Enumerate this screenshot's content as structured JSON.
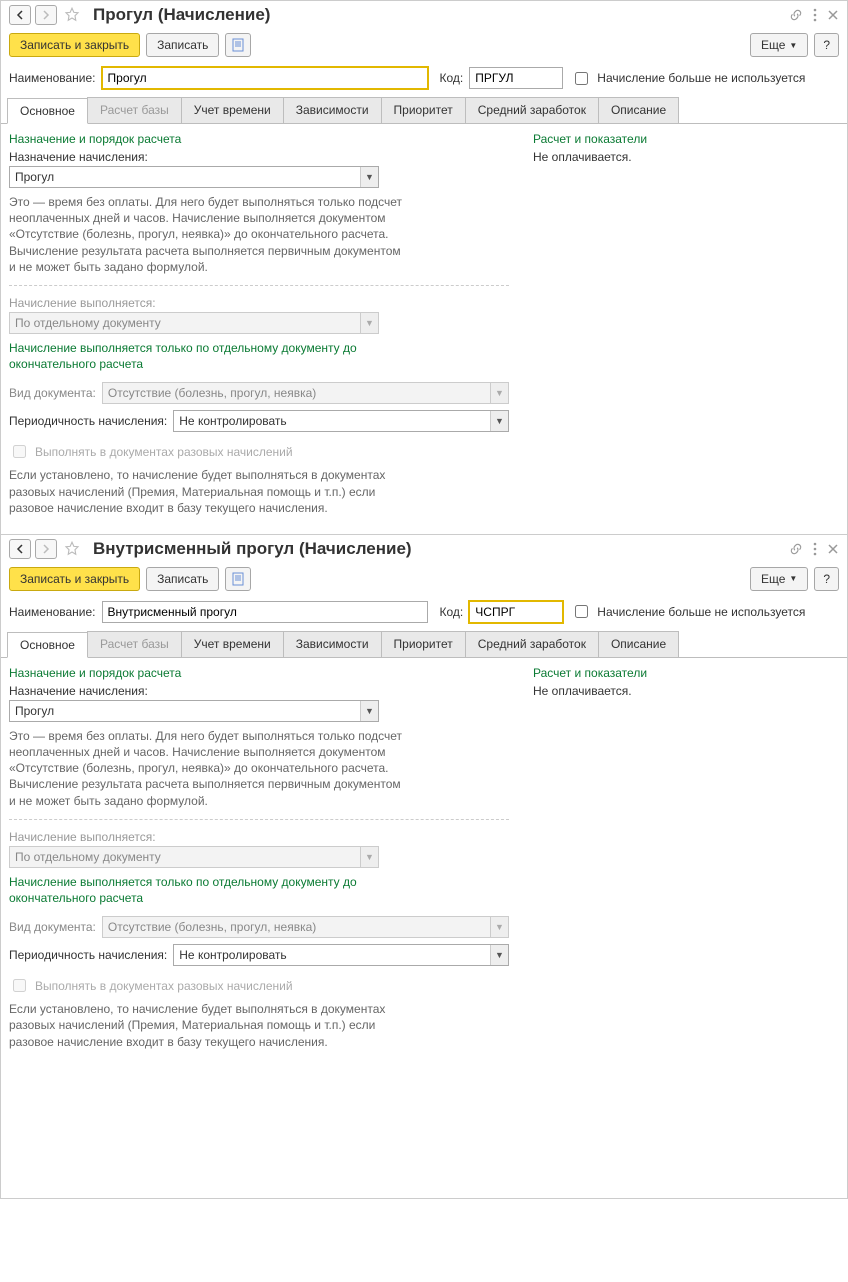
{
  "window1": {
    "title": "Прогул (Начисление)",
    "toolbar": {
      "save_close": "Записать и закрыть",
      "save": "Записать",
      "more": "Еще",
      "help": "?"
    },
    "fields": {
      "name_label": "Наименование:",
      "name_value": "Прогул",
      "code_label": "Код:",
      "code_value": "ПРГУЛ",
      "not_used": "Начисление больше не используется"
    },
    "tabs": [
      "Основное",
      "Расчет базы",
      "Учет времени",
      "Зависимости",
      "Приоритет",
      "Средний заработок",
      "Описание"
    ],
    "left": {
      "h1": "Назначение и порядок расчета",
      "assign_label": "Назначение начисления:",
      "assign_value": "Прогул",
      "desc1": "Это — время без оплаты. Для него будет выполняться только подсчет неоплаченных дней и часов. Начисление выполняется документом «Отсутствие (болезнь, прогул, неявка)» до окончательного расчета.\nВычисление результата расчета выполняется первичным документом и не может быть задано формулой.",
      "exec_label": "Начисление выполняется:",
      "exec_value": "По отдельному документу",
      "exec_desc": "Начисление выполняется только по отдельному документу до окончательного расчета",
      "doc_label": "Вид документа:",
      "doc_value": "Отсутствие (болезнь, прогул, неявка)",
      "period_label": "Периодичность начисления:",
      "period_value": "Не контролировать",
      "onetime_cb": "Выполнять в документах разовых начислений",
      "onetime_desc": "Если установлено, то начисление будет выполняться в документах разовых начислений (Премия, Материальная помощь и т.п.) если разовое начисление входит в базу текущего начисления."
    },
    "right": {
      "h1": "Расчет и показатели",
      "text": "Не оплачивается."
    }
  },
  "window2": {
    "title": "Внутрисменный прогул (Начисление)",
    "toolbar": {
      "save_close": "Записать и закрыть",
      "save": "Записать",
      "more": "Еще",
      "help": "?"
    },
    "fields": {
      "name_label": "Наименование:",
      "name_value": "Внутрисменный прогул",
      "code_label": "Код:",
      "code_value": "ЧСПРГ",
      "not_used": "Начисление больше не используется"
    },
    "tabs": [
      "Основное",
      "Расчет базы",
      "Учет времени",
      "Зависимости",
      "Приоритет",
      "Средний заработок",
      "Описание"
    ],
    "left": {
      "h1": "Назначение и порядок расчета",
      "assign_label": "Назначение начисления:",
      "assign_value": "Прогул",
      "desc1": "Это — время без оплаты. Для него будет выполняться только подсчет неоплаченных дней и часов. Начисление выполняется документом «Отсутствие (болезнь, прогул, неявка)» до окончательного расчета.\nВычисление результата расчета выполняется первичным документом и не может быть задано формулой.",
      "exec_label": "Начисление выполняется:",
      "exec_value": "По отдельному документу",
      "exec_desc": "Начисление выполняется только по отдельному документу до окончательного расчета",
      "doc_label": "Вид документа:",
      "doc_value": "Отсутствие (болезнь, прогул, неявка)",
      "period_label": "Периодичность начисления:",
      "period_value": "Не контролировать",
      "onetime_cb": "Выполнять в документах разовых начислений",
      "onetime_desc": "Если установлено, то начисление будет выполняться в документах разовых начислений (Премия, Материальная помощь и т.п.) если разовое начисление входит в базу текущего начисления."
    },
    "right": {
      "h1": "Расчет и показатели",
      "text": "Не оплачивается."
    }
  }
}
